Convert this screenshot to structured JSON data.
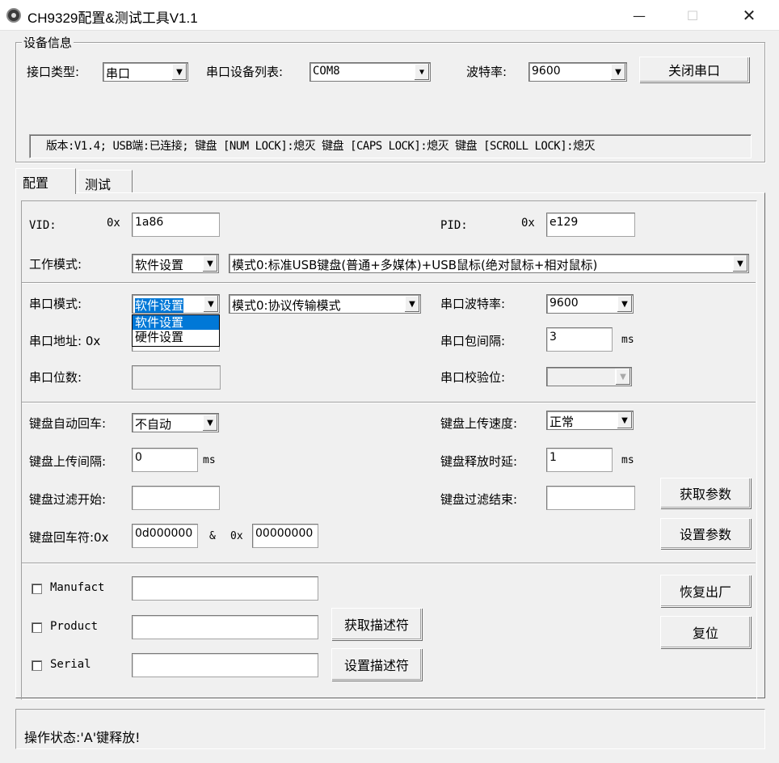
{
  "window": {
    "title": "CH9329配置&测试工具V1.1",
    "minimize": "—",
    "maximize": "☐",
    "close": "✕"
  },
  "device": {
    "legend": "设备信息",
    "interface_label": "接口类型:",
    "interface_value": "串口",
    "serial_list_label": "串口设备列表:",
    "serial_list_value": "COM8",
    "baud_label": "波特率:",
    "baud_value": "9600",
    "close_port_button": "关闭串口",
    "status_line": "版本:V1.4;  USB端:已连接;  键盘 [NUM LOCK]:熄灭  键盘 [CAPS LOCK]:熄灭  键盘 [SCROLL LOCK]:熄灭"
  },
  "tabs": [
    {
      "label": "配置",
      "active": true
    },
    {
      "label": "测试",
      "active": false
    }
  ],
  "config": {
    "vid_label": "VID:",
    "vid_prefix": "0x",
    "vid_value": "1a86",
    "pid_label": "PID:",
    "pid_prefix": "0x",
    "pid_value": "e129",
    "work_mode_label": "工作模式:",
    "work_mode_value": "软件设置",
    "work_mode_detail": "模式0:标准USB键盘(普通+多媒体)+USB鼠标(绝对鼠标+相对鼠标)",
    "serial_mode_label": "串口模式:",
    "serial_mode_value": "软件设置",
    "serial_mode_options": [
      "软件设置",
      "硬件设置"
    ],
    "serial_mode_detail": "模式0:协议传输模式",
    "serial_baud_label": "串口波特率:",
    "serial_baud_value": "9600",
    "serial_addr_label": "串口地址: 0x",
    "serial_interval_label": "串口包间隔:",
    "serial_interval_value": "3",
    "serial_interval_unit": "ms",
    "serial_bits_label": "串口位数:",
    "serial_parity_label": "串口校验位:",
    "kb_auto_enter_label": "键盘自动回车:",
    "kb_auto_enter_value": "不自动",
    "kb_upload_speed_label": "键盘上传速度:",
    "kb_upload_speed_value": "正常",
    "kb_upload_interval_label": "键盘上传间隔:",
    "kb_upload_interval_value": "0",
    "kb_upload_interval_unit": "ms",
    "kb_release_delay_label": "键盘释放时延:",
    "kb_release_delay_value": "1",
    "kb_release_delay_unit": "ms",
    "kb_filter_start_label": "键盘过滤开始:",
    "kb_filter_end_label": "键盘过滤结束:",
    "get_params_button": "获取参数",
    "kb_enter_char_label": "键盘回车符:0x",
    "kb_enter_char_value1": "0d000000",
    "kb_enter_char_amp": "&",
    "kb_enter_char_prefix2": "0x",
    "kb_enter_char_value2": "00000000",
    "set_params_button": "设置参数",
    "manufact_label": "Manufact",
    "product_label": "Product",
    "serial_label": "Serial",
    "get_desc_button": "获取描述符",
    "set_desc_button": "设置描述符",
    "factory_reset_button": "恢复出厂",
    "reset_button": "复位"
  },
  "status_bar": {
    "text": "操作状态:'A'键释放!"
  }
}
